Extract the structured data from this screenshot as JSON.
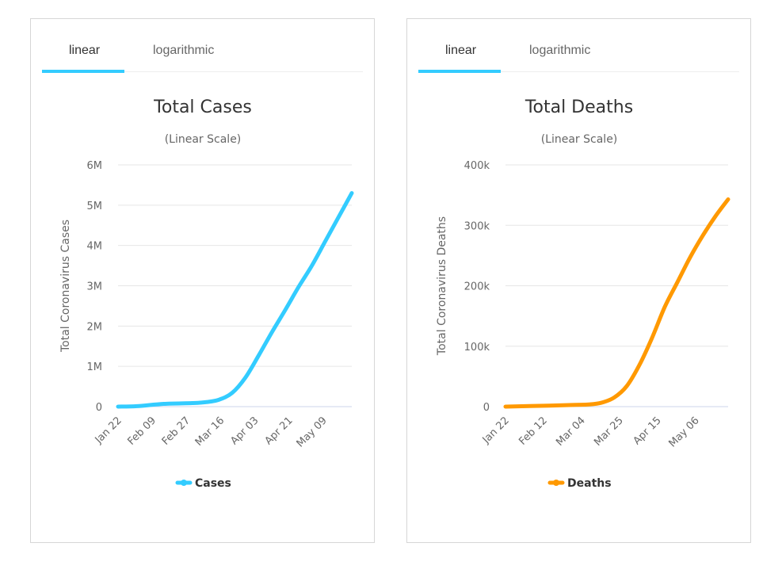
{
  "panels": [
    {
      "tabs": [
        {
          "label": "linear",
          "active": true
        },
        {
          "label": "logarithmic",
          "active": false
        }
      ],
      "legend_label": "Cases"
    },
    {
      "tabs": [
        {
          "label": "linear",
          "active": true
        },
        {
          "label": "logarithmic",
          "active": false
        }
      ],
      "legend_label": "Deaths"
    }
  ],
  "chart_data": [
    {
      "type": "line",
      "title": "Total Cases",
      "subtitle": "(Linear Scale)",
      "xlabel": "",
      "ylabel": "Total Coronavirus Cases",
      "ylim": [
        0,
        6000000
      ],
      "yticks": [
        0,
        1000000,
        2000000,
        3000000,
        4000000,
        5000000,
        6000000
      ],
      "ytick_labels": [
        "0",
        "1M",
        "2M",
        "3M",
        "4M",
        "5M",
        "6M"
      ],
      "xtick_labels": [
        "Jan 22",
        "Feb 09",
        "Feb 27",
        "Mar 16",
        "Apr 03",
        "Apr 21",
        "May 09"
      ],
      "xtick_dates": [
        "2020-01-22",
        "2020-02-09",
        "2020-02-27",
        "2020-03-16",
        "2020-04-03",
        "2020-04-21",
        "2020-05-09"
      ],
      "xlim": [
        "2020-01-22",
        "2020-05-24"
      ],
      "grid": true,
      "legend_position": "bottom",
      "series": [
        {
          "name": "Cases",
          "color": "#33ccff",
          "x": [
            "2020-01-22",
            "2020-02-01",
            "2020-02-15",
            "2020-03-01",
            "2020-03-08",
            "2020-03-15",
            "2020-03-22",
            "2020-03-29",
            "2020-04-05",
            "2020-04-12",
            "2020-04-19",
            "2020-04-26",
            "2020-05-03",
            "2020-05-10",
            "2020-05-17",
            "2020-05-24"
          ],
          "values": [
            580,
            12000,
            69000,
            88000,
            110000,
            170000,
            340000,
            720000,
            1270000,
            1850000,
            2400000,
            2970000,
            3500000,
            4100000,
            4700000,
            5300000
          ]
        }
      ]
    },
    {
      "type": "line",
      "title": "Total Deaths",
      "subtitle": "(Linear Scale)",
      "xlabel": "",
      "ylabel": "Total Coronavirus Deaths",
      "ylim": [
        0,
        400000
      ],
      "yticks": [
        0,
        100000,
        200000,
        300000,
        400000
      ],
      "ytick_labels": [
        "0",
        "100k",
        "200k",
        "300k",
        "400k"
      ],
      "xtick_labels": [
        "Jan 22",
        "Feb 12",
        "Mar 04",
        "Mar 25",
        "Apr 15",
        "May 06"
      ],
      "xtick_dates": [
        "2020-01-22",
        "2020-02-12",
        "2020-03-04",
        "2020-03-25",
        "2020-04-15",
        "2020-05-06"
      ],
      "xlim": [
        "2020-01-22",
        "2020-05-24"
      ],
      "grid": true,
      "legend_position": "bottom",
      "series": [
        {
          "name": "Deaths",
          "color": "#ff9900",
          "x": [
            "2020-01-22",
            "2020-02-15",
            "2020-03-01",
            "2020-03-08",
            "2020-03-15",
            "2020-03-22",
            "2020-03-29",
            "2020-04-05",
            "2020-04-12",
            "2020-04-19",
            "2020-04-26",
            "2020-05-03",
            "2020-05-10",
            "2020-05-17",
            "2020-05-24"
          ],
          "values": [
            17,
            1700,
            3000,
            3600,
            6500,
            15000,
            34000,
            69000,
            114000,
            165000,
            206000,
            247000,
            283000,
            315000,
            343000
          ]
        }
      ]
    }
  ]
}
